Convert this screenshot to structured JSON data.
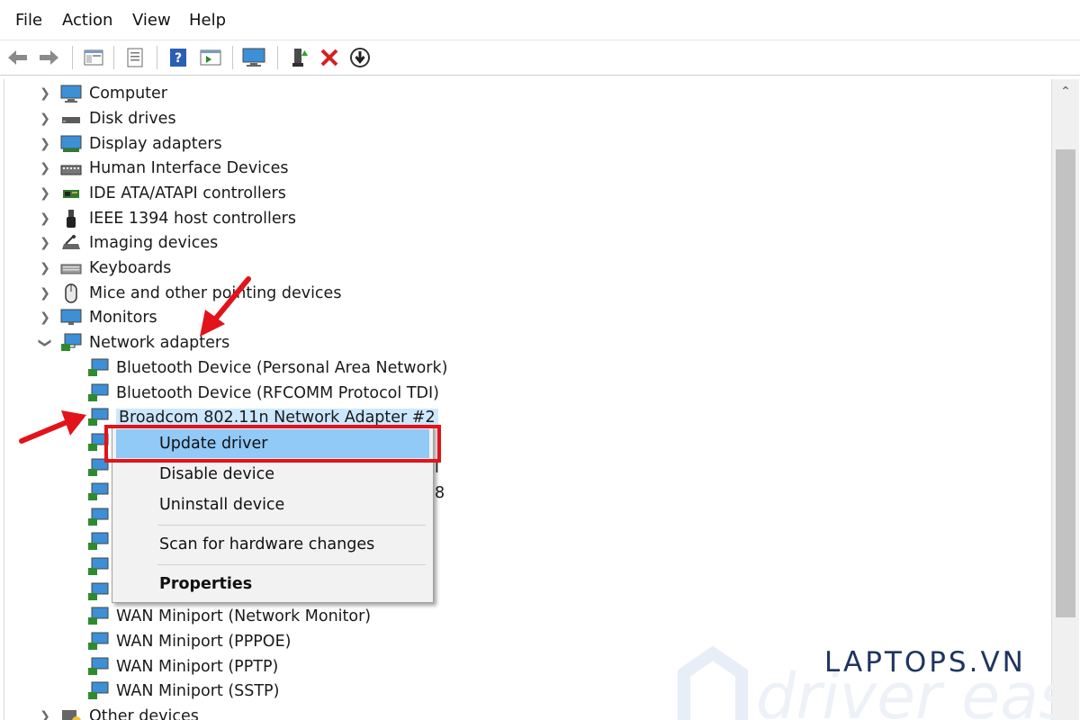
{
  "menu": [
    "File",
    "Action",
    "View",
    "Help"
  ],
  "toolbar": {
    "buttons": [
      "back-icon",
      "forward-icon",
      "show-hide-tree-icon",
      "properties-icon",
      "help-icon",
      "action-pane-icon",
      "display-computer-icon",
      "add-driver-icon",
      "uninstall-x-icon",
      "download-arrow-icon"
    ]
  },
  "tree": {
    "categories": [
      {
        "label": "Computer",
        "icon": "computer-icon"
      },
      {
        "label": "Disk drives",
        "icon": "disk-drive-icon"
      },
      {
        "label": "Display adapters",
        "icon": "display-adapter-icon"
      },
      {
        "label": "Human Interface Devices",
        "icon": "hid-icon"
      },
      {
        "label": "IDE ATA/ATAPI controllers",
        "icon": "ide-controller-icon"
      },
      {
        "label": "IEEE 1394 host controllers",
        "icon": "ieee1394-icon"
      },
      {
        "label": "Imaging devices",
        "icon": "imaging-device-icon"
      },
      {
        "label": "Keyboards",
        "icon": "keyboard-icon"
      },
      {
        "label": "Mice and other pointing devices",
        "icon": "mouse-icon"
      },
      {
        "label": "Monitors",
        "icon": "monitor-icon"
      },
      {
        "label": "Network adapters",
        "icon": "network-adapter-icon",
        "expanded": true
      }
    ],
    "network_children": [
      "Bluetooth Device (Personal Area Network)",
      "Bluetooth Device (RFCOMM Protocol TDI)",
      "Broadcom 802.11n Network Adapter #2",
      "",
      "",
      "",
      "",
      "",
      "",
      "",
      "WAN Miniport (Network Monitor)",
      "WAN Miniport (PPPOE)",
      "WAN Miniport (PPTP)",
      "WAN Miniport (SSTP)"
    ],
    "partial_suffix_1": "l",
    "partial_suffix_2": "8",
    "last_category": "Other devices"
  },
  "context_menu": {
    "items": [
      "Update driver",
      "Disable device",
      "Uninstall device",
      "Scan for hardware changes",
      "Properties"
    ],
    "highlighted": "Update driver"
  },
  "watermark": "LAPTOPS.VN",
  "background_logo": "driver easy",
  "colors": {
    "highlight": "#91c9f7",
    "annotation_red": "#e2131b",
    "selection": "#cce8ff",
    "watermark": "#1f3560"
  }
}
